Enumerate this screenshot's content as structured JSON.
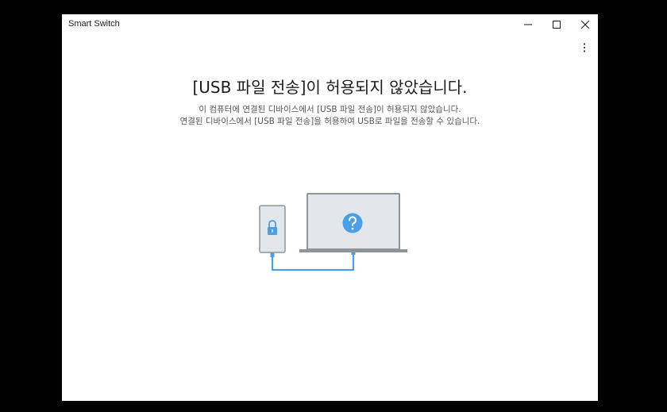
{
  "window": {
    "title": "Smart Switch"
  },
  "titlebar": {
    "minimize_icon": "minimize-icon",
    "maximize_icon": "maximize-icon",
    "close_icon": "close-icon"
  },
  "menu": {
    "more_icon": "more-vertical-icon"
  },
  "main": {
    "headline": "[USB 파일 전송]이 허용되지 않았습니다.",
    "description_line1": "이 컴퓨터에 연결된 디바이스에서 [USB 파일 전송]이 허용되지 않았습니다.",
    "description_line2": "연결된 디바이스에서 [USB 파일 전송]을 허용하여 USB로 파일을 전송할 수 있습니다."
  },
  "illustration": {
    "phone_icon": "phone-icon",
    "lock_icon": "lock-icon",
    "laptop_icon": "laptop-icon",
    "question_icon": "question-icon",
    "cable_icon": "usb-cable-icon"
  },
  "colors": {
    "accent_blue": "#4a9fe8",
    "device_gray": "#8e949a",
    "device_fill": "#e3e6ea",
    "background": "#ffffff"
  }
}
